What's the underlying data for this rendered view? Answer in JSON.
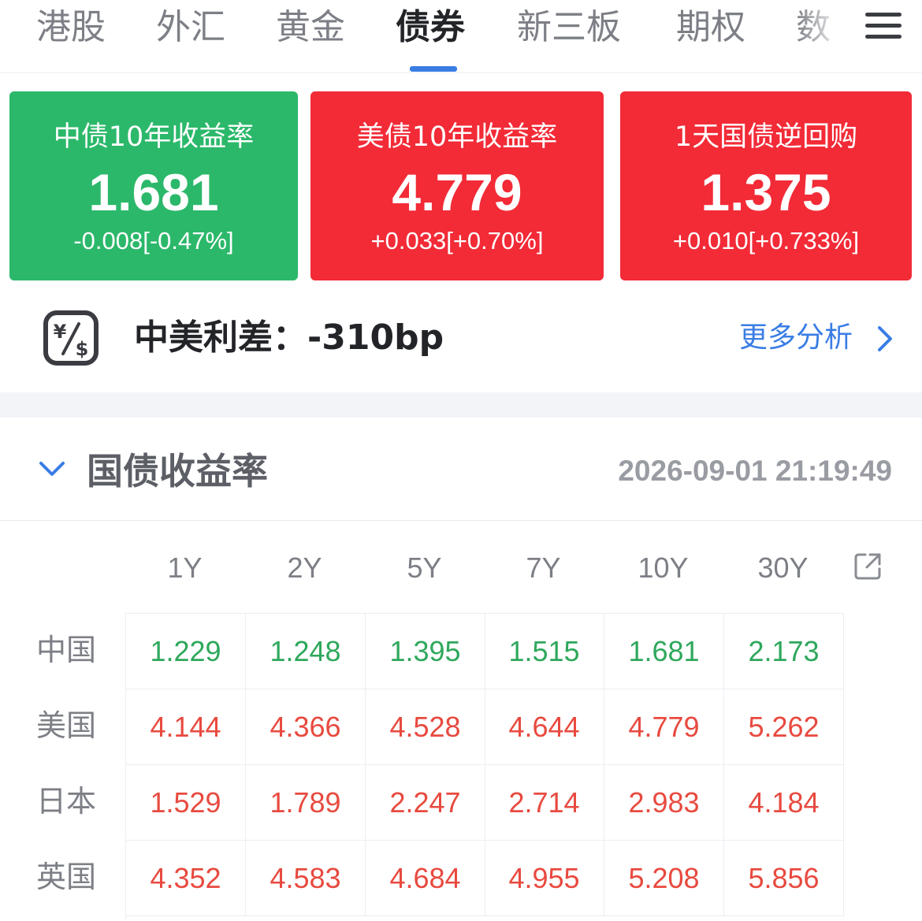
{
  "tabs": [
    {
      "label": "港股",
      "active": false
    },
    {
      "label": "外汇",
      "active": false
    },
    {
      "label": "黄金",
      "active": false
    },
    {
      "label": "债券",
      "active": true
    },
    {
      "label": "新三板",
      "active": false
    },
    {
      "label": "期权",
      "active": false
    },
    {
      "label": "数",
      "active": false
    }
  ],
  "menu_icon": "hamburger-menu-icon",
  "cards": [
    {
      "title": "中债10年收益率",
      "value": "1.681",
      "change": "-0.008[-0.47%]",
      "color": "#2bb86a"
    },
    {
      "title": "美债10年收益率",
      "value": "4.779",
      "change": "+0.033[+0.70%]",
      "color": "#f22b37"
    },
    {
      "title": "1天国债逆回购",
      "value": "1.375",
      "change": "+0.010[+0.733%]",
      "color": "#f22b37"
    }
  ],
  "spread": {
    "icon": "currency-exchange-icon",
    "text": "中美利差：-310bp",
    "more_label": "更多分析"
  },
  "section": {
    "title": "国债收益率",
    "timestamp": "2026-09-01 21:19:49"
  },
  "table": {
    "columns": [
      "1Y",
      "2Y",
      "5Y",
      "7Y",
      "10Y",
      "30Y"
    ],
    "rows": [
      {
        "label": "中国",
        "values": [
          "1.229",
          "1.248",
          "1.395",
          "1.515",
          "1.681",
          "2.173"
        ],
        "trend": "down"
      },
      {
        "label": "美国",
        "values": [
          "4.144",
          "4.366",
          "4.528",
          "4.644",
          "4.779",
          "5.262"
        ],
        "trend": "up"
      },
      {
        "label": "日本",
        "values": [
          "1.529",
          "1.789",
          "2.247",
          "2.714",
          "2.983",
          "4.184"
        ],
        "trend": "up"
      },
      {
        "label": "英国",
        "values": [
          "4.352",
          "4.583",
          "4.684",
          "4.955",
          "5.208",
          "5.856"
        ],
        "trend": "up"
      }
    ]
  },
  "colors": {
    "accent": "#3a7de5",
    "up": "#e84a3f",
    "down": "#2ea85c"
  }
}
